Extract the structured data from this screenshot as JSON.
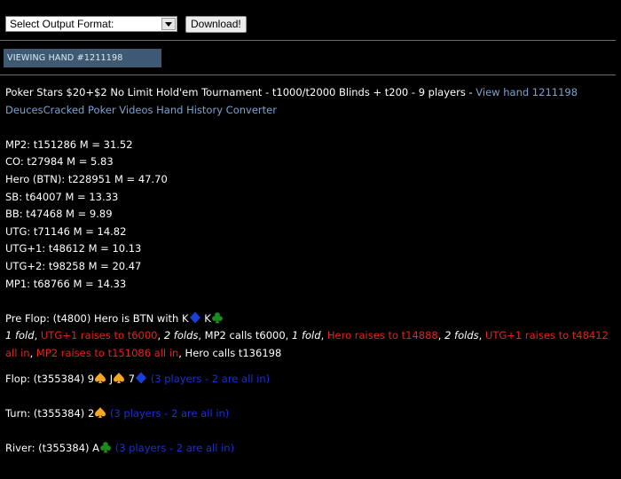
{
  "toolbar": {
    "select_value": "Select Output Format:",
    "download_label": "Download!"
  },
  "viewing_label": "VIEWING HAND #1211198",
  "header": {
    "title": "Poker Stars $20+$2 No Limit Hold'em Tournament - t1000/t2000 Blinds + t200 - 9 players - ",
    "view_link": "View hand 1211198",
    "converter_link": "DeucesCracked Poker Videos Hand History Converter"
  },
  "players": [
    "MP2: t151286 M = 31.52",
    "CO: t27984 M = 5.83",
    "Hero (BTN): t228951 M = 47.70",
    "SB: t64007 M = 13.33",
    "BB: t47468 M = 9.89",
    "UTG: t71146 M = 14.82",
    "UTG+1: t48612 M = 10.13",
    "UTG+2: t98258 M = 20.47",
    "MP1: t68766 M = 14.33"
  ],
  "preflop": {
    "intro": "Pre Flop: (t4800) Hero is BTN with ",
    "card1_rank": "K",
    "card1_suit": "diamond",
    "card2_rank": "K",
    "card2_suit": "club",
    "actions": [
      {
        "text": "1 fold",
        "style": "ital"
      },
      {
        "text": ", ",
        "style": ""
      },
      {
        "text": "UTG+1 raises to t6000",
        "style": "red"
      },
      {
        "text": ", ",
        "style": ""
      },
      {
        "text": "2 folds",
        "style": "ital"
      },
      {
        "text": ", MP2 calls t6000, ",
        "style": ""
      },
      {
        "text": "1 fold",
        "style": "ital"
      },
      {
        "text": ", ",
        "style": ""
      },
      {
        "text": "Hero raises to t14888",
        "style": "red"
      },
      {
        "text": ", ",
        "style": ""
      },
      {
        "text": "2 folds",
        "style": "ital"
      },
      {
        "text": ", ",
        "style": ""
      },
      {
        "text": "UTG+1 raises to t48412 all in",
        "style": "red"
      },
      {
        "text": ", ",
        "style": ""
      },
      {
        "text": "MP2 raises to t151086 all in",
        "style": "red"
      },
      {
        "text": ", Hero calls t136198",
        "style": ""
      }
    ]
  },
  "flop": {
    "intro": "Flop: (t355384) ",
    "cards": [
      {
        "rank": "9",
        "suit": "spade"
      },
      {
        "rank": "J",
        "suit": "spade"
      },
      {
        "rank": "7",
        "suit": "diamond"
      }
    ],
    "note": "(3 players - 2 are all in)"
  },
  "turn": {
    "intro": "Turn: (t355384) ",
    "cards": [
      {
        "rank": "2",
        "suit": "spade"
      }
    ],
    "note": "(3 players - 2 are all in)"
  },
  "river": {
    "intro": "River: (t355384) ",
    "cards": [
      {
        "rank": "A",
        "suit": "club"
      }
    ],
    "note": "(3 players - 2 are all in)"
  },
  "suit_colors": {
    "spade": "#f5a623",
    "diamond": "#1a3fd6",
    "club": "#1e8a1e",
    "heart": "#d81e1e"
  }
}
